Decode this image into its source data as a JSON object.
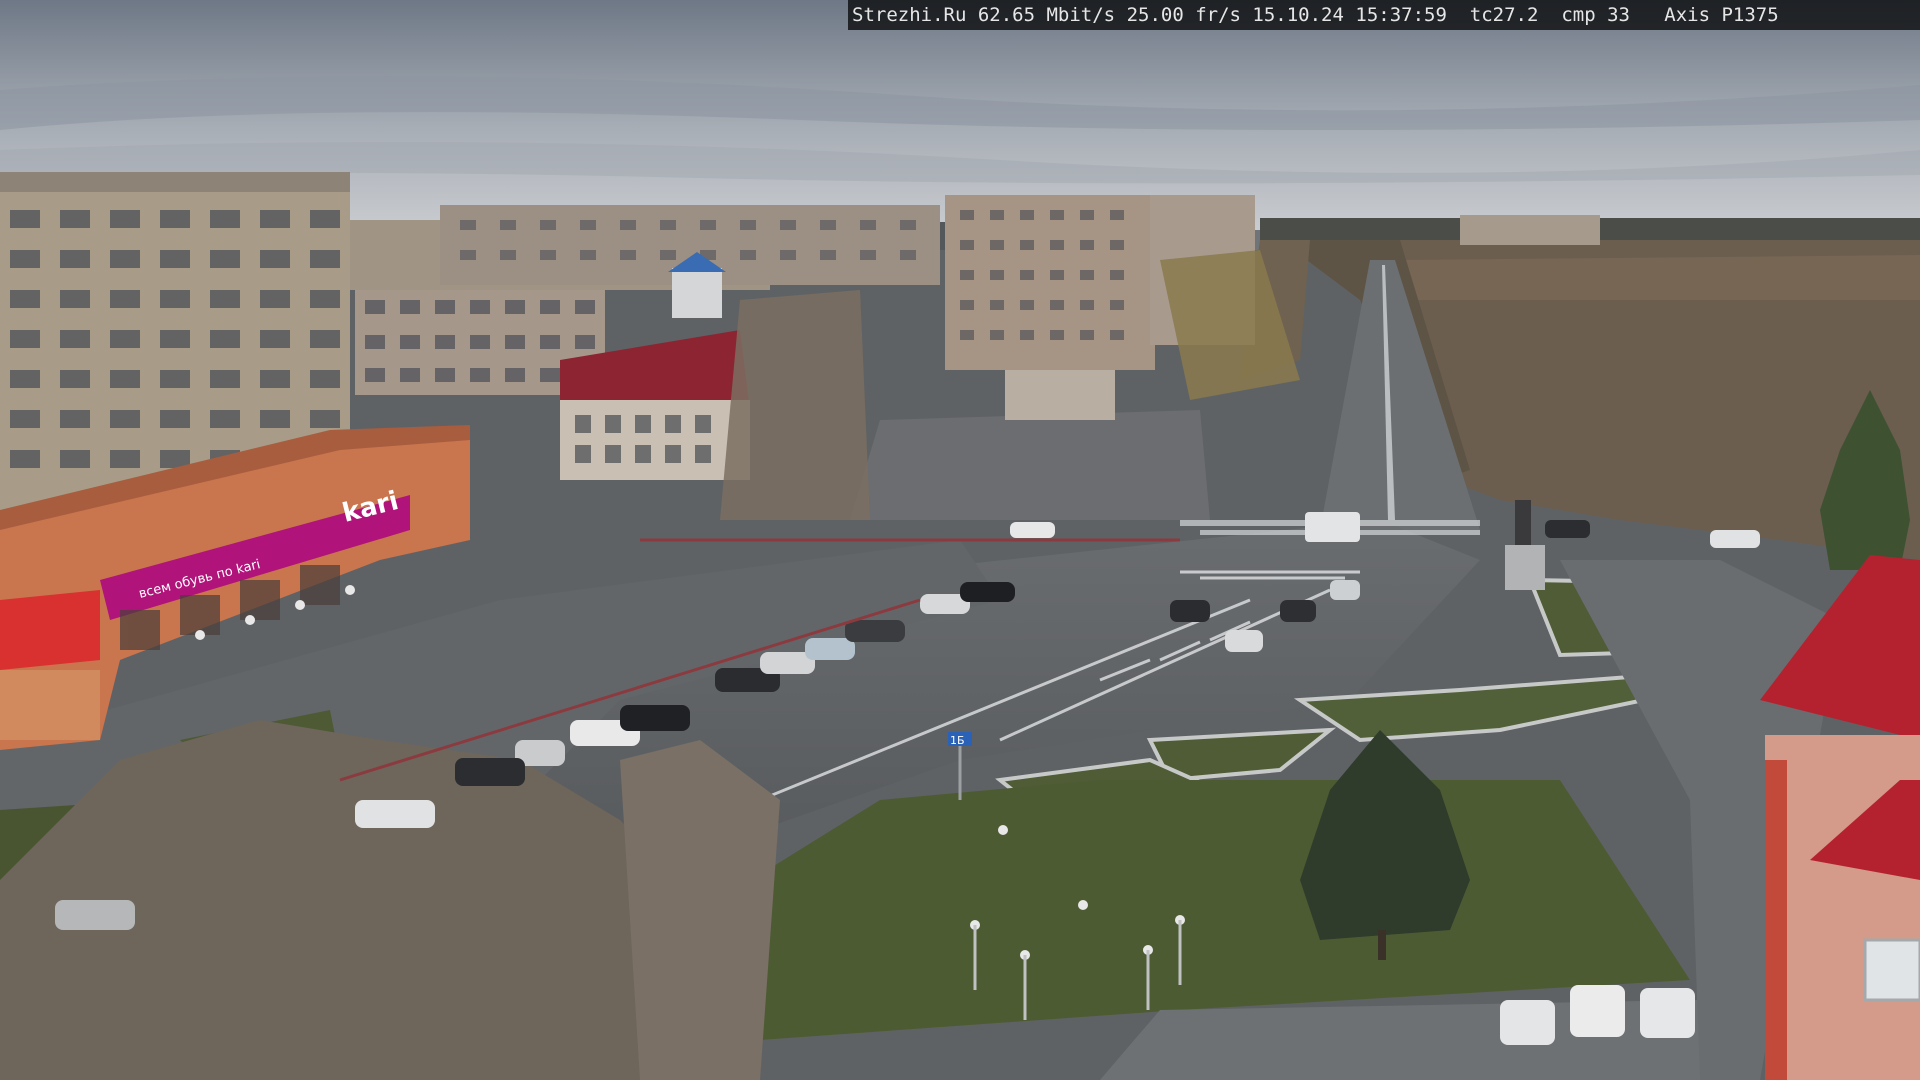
{
  "overlay": {
    "site": "Strezhi.Ru",
    "bitrate": "62.65 Mbit/s",
    "framerate": "25.00 fr/s",
    "date": "15.10.24",
    "time": "15:37:59",
    "tc": "tc27.2",
    "cmp": "cmp 33",
    "camera": "Axis P1375"
  },
  "signs": {
    "store_brand": "kari",
    "store_slogan": "всем обувь по kari",
    "bus_stop_label": "1Б"
  },
  "colors": {
    "sky_top": "#7d8795",
    "sky_bottom": "#c3c7cc",
    "road": "#5d6063",
    "grass": "#4d5a36",
    "kari_magenta": "#b0137a",
    "roof_red": "#b5222f"
  }
}
